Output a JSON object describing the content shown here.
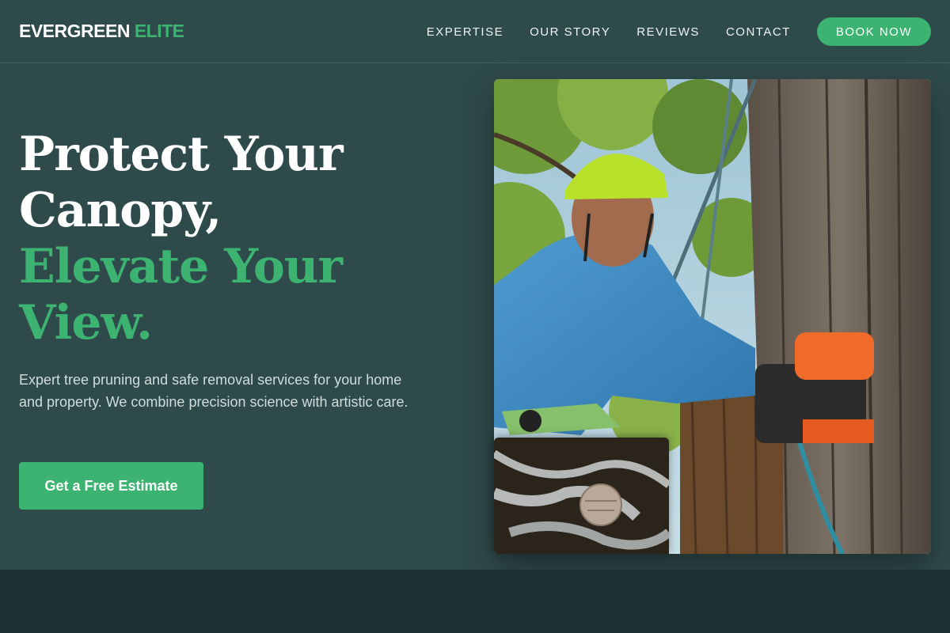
{
  "brand": {
    "name_part1": "EVERGREEN",
    "name_part2": "ELITE"
  },
  "nav": {
    "items": [
      {
        "label": "EXPERTISE"
      },
      {
        "label": "OUR STORY"
      },
      {
        "label": "REVIEWS"
      },
      {
        "label": "CONTACT"
      }
    ],
    "cta_label": "BOOK NOW"
  },
  "hero": {
    "headline_line1": "Protect Your",
    "headline_line2": "Canopy,",
    "headline_line3": "Elevate Your",
    "headline_line4": "View.",
    "subtitle": "Expert tree pruning and safe removal services for your home and property. We combine precision science with artistic care.",
    "cta_label": "Get a Free Estimate"
  },
  "colors": {
    "background": "#2f4a4b",
    "accent": "#3cb371",
    "footer_band": "#1d2f30"
  }
}
